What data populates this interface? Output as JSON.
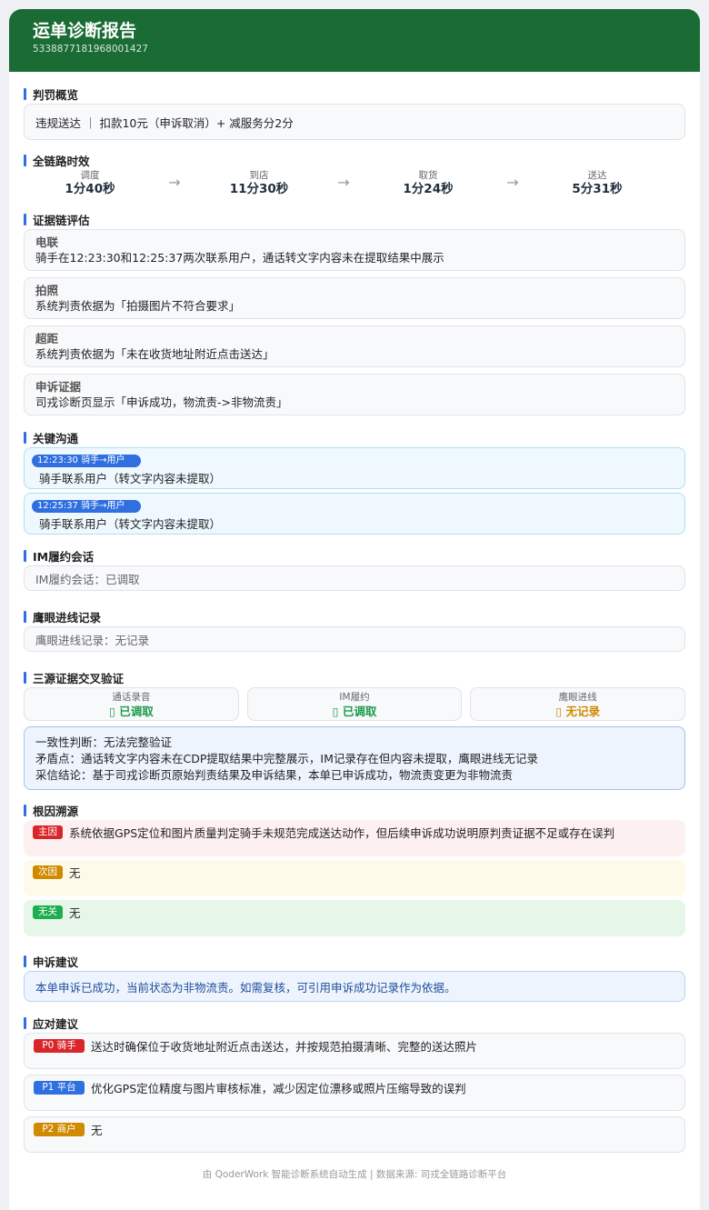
{
  "header": {
    "title": "运单诊断报告",
    "waybill_id": "5338877181968001427"
  },
  "penalty": {
    "title": "判罚概览",
    "text": "违规送达 ｜ 扣款10元（申诉取消）+ 减服务分2分"
  },
  "timeline": {
    "title": "全链路时效",
    "arrow": "→",
    "items": [
      {
        "label": "调度",
        "value": "1分40秒"
      },
      {
        "label": "到店",
        "value": "11分30秒"
      },
      {
        "label": "取货",
        "value": "1分24秒"
      },
      {
        "label": "送达",
        "value": "5分31秒"
      }
    ]
  },
  "evidence": {
    "title": "证据链评估",
    "items": [
      {
        "name": "电联",
        "text": "骑手在12:23:30和12:25:37两次联系用户，通话转文字内容未在提取结果中展示"
      },
      {
        "name": "拍照",
        "text": "系统判责依据为「拍摄图片不符合要求」"
      },
      {
        "name": "超距",
        "text": "系统判责依据为「未在收货地址附近点击送达」"
      },
      {
        "name": "申诉证据",
        "text": "司戎诊断页显示「申诉成功，物流责->非物流责」"
      }
    ]
  },
  "communication": {
    "title": "关键沟通",
    "items": [
      {
        "tag": "12:23:30  骑手→用户",
        "text": "骑手联系用户（转文字内容未提取）"
      },
      {
        "tag": "12:25:37  骑手→用户",
        "text": "骑手联系用户（转文字内容未提取）"
      }
    ]
  },
  "im": {
    "title": "IM履约会话",
    "text": "IM履约会话：已调取"
  },
  "eagle": {
    "title": "鹰眼进线记录",
    "text": "鹰眼进线记录：无记录"
  },
  "cross": {
    "title": "三源证据交叉验证",
    "items": [
      {
        "label": "通话录音",
        "value": "▯ 已调取",
        "color": "#1a9a4a"
      },
      {
        "label": "IM履约",
        "value": "▯ 已调取",
        "color": "#1a9a4a"
      },
      {
        "label": "鹰眼进线",
        "value": "▯ 无记录",
        "color": "#d08a00"
      }
    ],
    "consistency": "一致性判断：无法完整验证",
    "conflict": "矛盾点：通话转文字内容未在CDP提取结果中完整展示，IM记录存在但内容未提取，鹰眼进线无记录",
    "conclusion": "采信结论：基于司戎诊断页原始判责结果及申诉结果，本单已申诉成功，物流责变更为非物流责"
  },
  "root_cause": {
    "title": "根因溯源",
    "items": [
      {
        "badge": "主因",
        "text": "系统依据GPS定位和图片质量判定骑手未规范完成送达动作，但后续申诉成功说明原判责证据不足或存在误判",
        "badge_color": "#d9262b",
        "bg": "#fdf0f0"
      },
      {
        "badge": "次因",
        "text": "无",
        "badge_color": "#d08a00",
        "bg": "#fefaea"
      },
      {
        "badge": "无关",
        "text": "无",
        "badge_color": "#1fae4e",
        "bg": "#e6f7ea"
      }
    ]
  },
  "appeal": {
    "title": "申诉建议",
    "text": "本单申诉已成功，当前状态为非物流责。如需复核，可引用申诉成功记录作为依据。"
  },
  "recommendations": {
    "title": "应对建议",
    "items": [
      {
        "badge": "P0 骑手",
        "text": "送达时确保位于收货地址附近点击送达，并按规范拍摄清晰、完整的送达照片",
        "badge_color": "#d9262b"
      },
      {
        "badge": "P1 平台",
        "text": "优化GPS定位精度与图片审核标准，减少因定位漂移或照片压缩导致的误判",
        "badge_color": "#2f6fe0"
      },
      {
        "badge": "P2 商户",
        "text": "无",
        "badge_color": "#d08a00"
      }
    ]
  },
  "footer": "由 QoderWork 智能诊断系统自动生成 | 数据来源: 司戎全链路诊断平台"
}
